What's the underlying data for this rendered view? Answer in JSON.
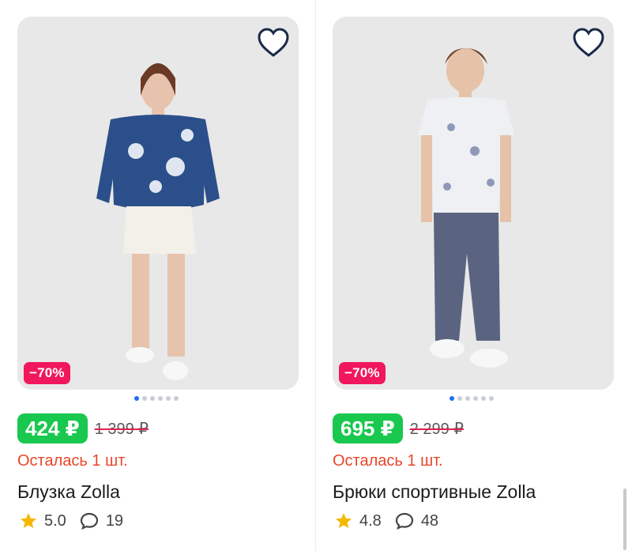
{
  "products": [
    {
      "discount": "−70%",
      "price": "424 ₽",
      "old_price": "1 399 ₽",
      "stock": "Осталась 1 шт.",
      "title": "Блузка Zolla",
      "rating": "5.0",
      "reviews": "19",
      "dots": 6,
      "active_dot": 0
    },
    {
      "discount": "−70%",
      "price": "695 ₽",
      "old_price": "2 299 ₽",
      "stock": "Осталась 1 шт.",
      "title": "Брюки спортивные Zolla",
      "rating": "4.8",
      "reviews": "48",
      "dots": 6,
      "active_dot": 0
    }
  ],
  "icons": {
    "favorite": "heart-outline-icon",
    "rating": "star-icon",
    "reviews": "comment-bubble-icon"
  },
  "colors": {
    "price_bg": "#19c84e",
    "discount_bg": "#f1175c",
    "stock_text": "#e8462a",
    "star": "#f5b800",
    "active_dot": "#1e6ff0"
  }
}
